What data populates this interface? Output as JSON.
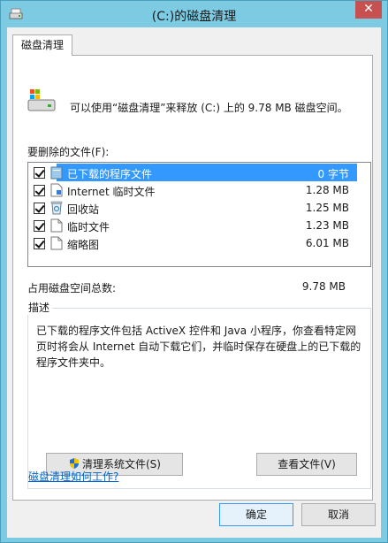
{
  "window": {
    "title": "(C:)的磁盘清理",
    "close_glyph": "✕"
  },
  "tab": {
    "label": "磁盘清理"
  },
  "intro": {
    "text": "可以使用“磁盘清理”来释放 (C:) 上的 9.78 MB 磁盘空间。"
  },
  "files": {
    "label": "要删除的文件(F):",
    "items": [
      {
        "name": "已下载的程序文件",
        "size": "0 字节",
        "checked": true,
        "selected": true,
        "icon": "folder-icon"
      },
      {
        "name": "Internet 临时文件",
        "size": "1.28 MB",
        "checked": true,
        "selected": false,
        "icon": "document-lock-icon"
      },
      {
        "name": "回收站",
        "size": "1.25 MB",
        "checked": true,
        "selected": false,
        "icon": "recycle-bin-icon"
      },
      {
        "name": "临时文件",
        "size": "1.23 MB",
        "checked": true,
        "selected": false,
        "icon": "document-icon"
      },
      {
        "name": "缩略图",
        "size": "6.01 MB",
        "checked": true,
        "selected": false,
        "icon": "document-icon"
      }
    ]
  },
  "total": {
    "label": "占用磁盘空间总数:",
    "value": "9.78 MB"
  },
  "description": {
    "title": "描述",
    "text": "已下载的程序文件包括 ActiveX 控件和 Java 小程序，你查看特定网页时将会从 Internet 自动下载它们，并临时保存在硬盘上的已下载的程序文件夹中。"
  },
  "buttons": {
    "clean_system": "清理系统文件(S)",
    "view_files": "查看文件(V)",
    "ok": "确定",
    "cancel": "取消"
  },
  "help_link": "磁盘清理如何工作?",
  "colors": {
    "selection": "#3399ff",
    "frame": "#7ccbe2",
    "link": "#0066cc"
  }
}
